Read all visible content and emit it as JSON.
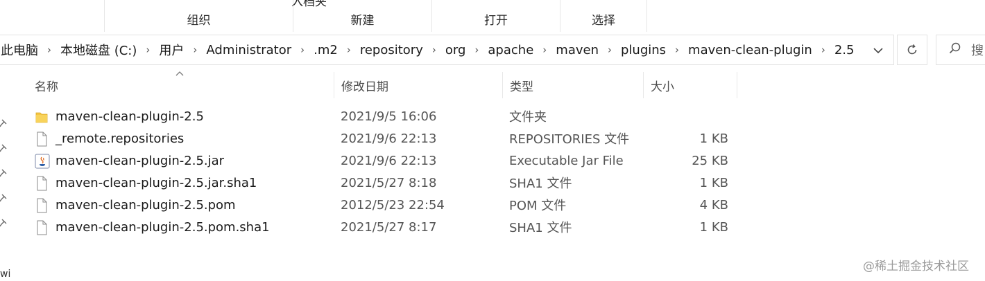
{
  "ribbon": {
    "cut_label": "入档夹",
    "groups": [
      "组织",
      "新建",
      "打开",
      "选择"
    ]
  },
  "address": {
    "crumbs": [
      "此电脑",
      "本地磁盘 (C:)",
      "用户",
      "Administrator",
      ".m2",
      "repository",
      "org",
      "apache",
      "maven",
      "plugins",
      "maven-clean-plugin",
      "2.5"
    ],
    "search_placeholder": "搜"
  },
  "columns": {
    "name": "名称",
    "date": "修改日期",
    "type": "类型",
    "size": "大小"
  },
  "files": [
    {
      "name": "maven-clean-plugin-2.5",
      "date": "2021/9/5 16:06",
      "type": "文件夹",
      "size": "",
      "icon": "folder-icon"
    },
    {
      "name": "_remote.repositories",
      "date": "2021/9/6 22:13",
      "type": "REPOSITORIES 文件",
      "size": "1 KB",
      "icon": "file-icon"
    },
    {
      "name": "maven-clean-plugin-2.5.jar",
      "date": "2021/9/6 22:13",
      "type": "Executable Jar File",
      "size": "25 KB",
      "icon": "java-jar-icon"
    },
    {
      "name": "maven-clean-plugin-2.5.jar.sha1",
      "date": "2021/5/27 8:18",
      "type": "SHA1 文件",
      "size": "1 KB",
      "icon": "file-icon"
    },
    {
      "name": "maven-clean-plugin-2.5.pom",
      "date": "2012/5/23 22:54",
      "type": "POM 文件",
      "size": "4 KB",
      "icon": "file-icon"
    },
    {
      "name": "maven-clean-plugin-2.5.pom.sha1",
      "date": "2021/5/27 8:17",
      "type": "SHA1 文件",
      "size": "1 KB",
      "icon": "file-icon"
    }
  ],
  "left_fragment": "wi",
  "watermark": "@稀土掘金技术社区",
  "colors": {
    "folder": "#f4c542",
    "border": "#e3e3e3"
  }
}
